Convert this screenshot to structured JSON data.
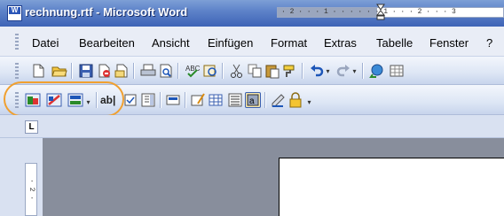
{
  "window": {
    "title": "rechnung.rtf - Microsoft Word",
    "app_icon": "word-document-icon"
  },
  "menubar": {
    "items": [
      "Datei",
      "Bearbeiten",
      "Ansicht",
      "Einfügen",
      "Format",
      "Extras",
      "Tabelle",
      "Fenster",
      "?"
    ]
  },
  "toolbar_standard": {
    "buttons": [
      "new-document-icon",
      "open-folder-icon",
      "save-icon",
      "permission-icon",
      "email-icon",
      "print-icon",
      "print-preview-icon",
      "spelling-icon",
      "research-icon",
      "cut-icon",
      "copy-icon",
      "paste-icon",
      "format-painter-icon",
      "undo-icon",
      "redo-icon",
      "hyperlink-icon"
    ]
  },
  "toolbar_forms": {
    "highlighted_buttons": [
      "form-button-1-icon",
      "form-button-2-icon",
      "form-button-3-icon"
    ],
    "text_field_label": "ab|",
    "buttons": [
      "checkbox-icon",
      "combo-box-icon",
      "form-field-options-icon",
      "draw-table-icon",
      "insert-table-icon",
      "insert-frame-icon",
      "form-field-shading-icon",
      "reset-form-icon",
      "protect-form-icon"
    ]
  },
  "ruler": {
    "tab_selector": "L",
    "text": "· 2 · · · 1 · · ·     · · · 1 · · · 2 · · · 3",
    "vertical_text": "· 2 ·"
  },
  "colors": {
    "titlebar": "#3e63b6",
    "menubar": "#e9edf6",
    "toolbar": "#dde6f5",
    "highlight": "#f0a030",
    "workspace": "#888e9c"
  }
}
